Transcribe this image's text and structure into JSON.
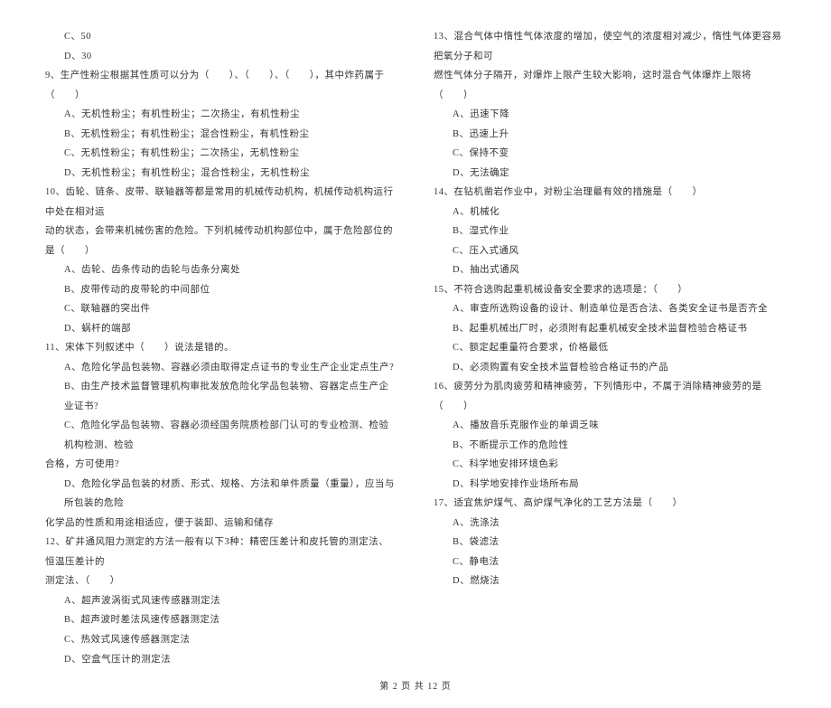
{
  "left": {
    "q8_c": "C、50",
    "q8_d": "D、30",
    "q9_stem": "9、生产性粉尘根据其性质可以分为（　　）、（　　）、（　　），其中炸药属于（　　）",
    "q9_a": "A、无机性粉尘；有机性粉尘；二次扬尘，有机性粉尘",
    "q9_b": "B、无机性粉尘；有机性粉尘；混合性粉尘，有机性粉尘",
    "q9_c": "C、无机性粉尘；有机性粉尘；二次扬尘，无机性粉尘",
    "q9_d": "D、无机性粉尘；有机性粉尘；混合性粉尘，无机性粉尘",
    "q10_stem_1": "10、齿轮、链条、皮带、联轴器等都是常用的机械传动机构，机械传动机构运行中处在相对运",
    "q10_stem_2": "动的状态，会带来机械伤害的危险。下列机械传动机构部位中，属于危险部位的是（　　）",
    "q10_a": "A、齿轮、齿条传动的齿轮与齿条分离处",
    "q10_b": "B、皮带传动的皮带轮的中间部位",
    "q10_c": "C、联轴器的突出件",
    "q10_d": "D、蜗杆的端部",
    "q11_stem": "11、宋体下列叙述中（　　）说法是错的。",
    "q11_a": "A、危险化学品包装物、容器必须由取得定点证书的专业生产企业定点生产?",
    "q11_b": "B、由生产技术监督管理机构审批发放危险化学品包装物、容器定点生产企业证书?",
    "q11_c_1": "C、危险化学品包装物、容器必须经国务院质检部门认可的专业检测、检验机构检测、检验",
    "q11_c_2": "合格，方可使用?",
    "q11_d_1": "D、危险化学品包装的材质、形式、规格、方法和单件质量（重量），应当与所包装的危险",
    "q11_d_2": "化学品的性质和用途相适应，便于装卸、运输和储存",
    "q12_stem_1": "12、矿井通风阻力测定的方法一般有以下3种：精密压差计和皮托管的测定法、恒温压差计的",
    "q12_stem_2": "测定法、（　　）",
    "q12_a": "A、超声波涡街式风速传感器测定法",
    "q12_b": "B、超声波时差法风速传感器测定法",
    "q12_c": "C、热效式风速传感器测定法",
    "q12_d": "D、空盒气压计的测定法"
  },
  "right": {
    "q13_stem_1": "13、混合气体中惰性气体浓度的增加，使空气的浓度相对减少，惰性气体更容易把氧分子和可",
    "q13_stem_2": "燃性气体分子隔开，对爆炸上限产生较大影响，这时混合气体爆炸上限将（　　）",
    "q13_a": "A、迅速下降",
    "q13_b": "B、迅速上升",
    "q13_c": "C、保持不变",
    "q13_d": "D、无法确定",
    "q14_stem": "14、在钻机凿岩作业中，对粉尘治理最有效的措施是（　　）",
    "q14_a": "A、机械化",
    "q14_b": "B、湿式作业",
    "q14_c": "C、压入式通风",
    "q14_d": "D、抽出式通风",
    "q15_stem": "15、不符合选购起重机械设备安全要求的选项是：（　　）",
    "q15_a": "A、审查所选购设备的设计、制造单位是否合法、各类安全证书是否齐全",
    "q15_b": "B、起重机械出厂时，必须附有起重机械安全技术监督检验合格证书",
    "q15_c": "C、额定起重量符合要求，价格最低",
    "q15_d": "D、必须购置有安全技术监督检验合格证书的产品",
    "q16_stem": "16、疲劳分为肌肉疲劳和精神疲劳，下列情形中，不属于消除精神疲劳的是（　　）",
    "q16_a": "A、播放音乐克服作业的单调乏味",
    "q16_b": "B、不断提示工作的危险性",
    "q16_c": "C、科学地安排环境色彩",
    "q16_d": "D、科学地安排作业场所布局",
    "q17_stem": "17、适宜焦炉煤气、高炉煤气净化的工艺方法是（　　）",
    "q17_a": "A、洗涤法",
    "q17_b": "B、袋滤法",
    "q17_c": "C、静电法",
    "q17_d": "D、燃烧法"
  },
  "footer": "第 2 页 共 12 页"
}
